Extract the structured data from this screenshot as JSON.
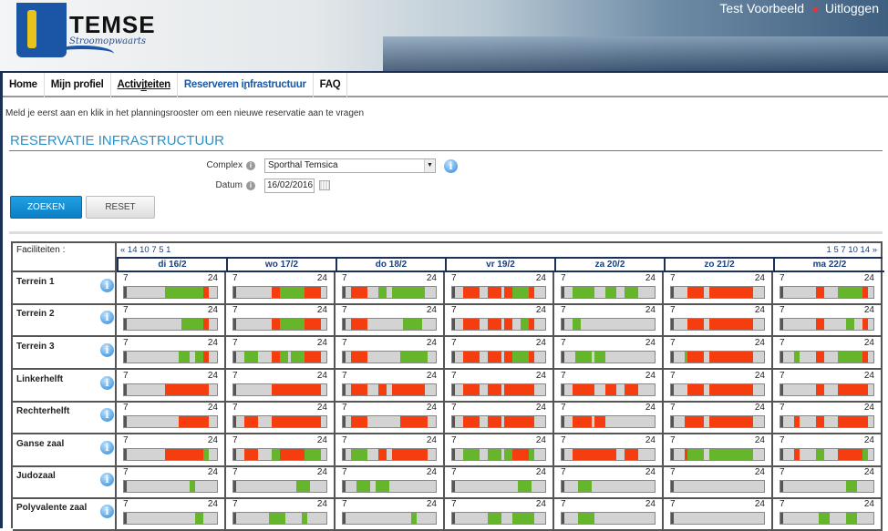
{
  "header": {
    "brand": "TEMSE",
    "slogan": "Stroomopwaarts",
    "user": "Test Voorbeeld",
    "logout": "Uitloggen"
  },
  "nav": [
    {
      "label": "Home"
    },
    {
      "label": "Mijn profiel"
    },
    {
      "label": "Activiteiten",
      "dropdown": true,
      "underline": true
    },
    {
      "label": "Reserveren infrastructuur",
      "dropdown": true,
      "active": true
    },
    {
      "label": "FAQ"
    }
  ],
  "hint": "Meld je eerst aan en klik in het planningsrooster om een nieuwe reservatie aan te vragen",
  "title": "RESERVATIE INFRASTRUCTUUR",
  "form": {
    "complex_label": "Complex",
    "complex_value": "Sporthal Temsica",
    "datum_label": "Datum",
    "datum_value": "16/02/2016",
    "search": "ZOEKEN",
    "reset": "RESET"
  },
  "colors": {
    "reserved": "#f53d0f",
    "free_slot": "#65b62a",
    "empty": "#d3d3d3",
    "accent": "#2b92c9"
  },
  "grid": {
    "facilities_header": "Faciliteiten :",
    "pager_prev": "« 14 10 7 5 1",
    "pager_next": "1 5 7 10 14 »",
    "scale_start": "7",
    "scale_end": "24",
    "days": [
      "di 16/2",
      "wo 17/2",
      "do 18/2",
      "vr 19/2",
      "za 20/2",
      "zo 21/2",
      "ma 22/2"
    ],
    "rows": [
      {
        "name": "Terrein 1",
        "days": [
          [
            [
              14.5,
              21.5,
              "g"
            ],
            [
              21.5,
              22.5,
              "r"
            ]
          ],
          [
            [
              14,
              15.5,
              "r"
            ],
            [
              15.5,
              20,
              "g"
            ],
            [
              20,
              23,
              "r"
            ]
          ],
          [
            [
              8.5,
              11.5,
              "r"
            ],
            [
              13.5,
              15,
              "g"
            ],
            [
              16,
              22,
              "g"
            ]
          ],
          [
            [
              9,
              12,
              "r"
            ],
            [
              13.5,
              16,
              "r"
            ],
            [
              16.5,
              18,
              "r"
            ],
            [
              18,
              21,
              "g"
            ],
            [
              21,
              22,
              "r"
            ]
          ],
          [
            [
              9,
              13,
              "g"
            ],
            [
              15,
              17,
              "g"
            ],
            [
              18.5,
              21,
              "g"
            ]
          ],
          [
            [
              10,
              13,
              "r"
            ],
            [
              14,
              22,
              "r"
            ]
          ],
          [
            [
              13.5,
              15,
              "r"
            ],
            [
              17.5,
              22,
              "g"
            ],
            [
              22,
              23,
              "r"
            ]
          ]
        ]
      },
      {
        "name": "Terrein 2",
        "days": [
          [
            [
              17.5,
              21.5,
              "g"
            ],
            [
              21.5,
              22.5,
              "r"
            ]
          ],
          [
            [
              14,
              15.5,
              "r"
            ],
            [
              15.5,
              20,
              "g"
            ],
            [
              20,
              23,
              "r"
            ]
          ],
          [
            [
              8.5,
              11.5,
              "r"
            ],
            [
              18,
              21.5,
              "g"
            ]
          ],
          [
            [
              9,
              12,
              "r"
            ],
            [
              13.5,
              16,
              "r"
            ],
            [
              16.5,
              18,
              "r"
            ],
            [
              19.5,
              21,
              "g"
            ],
            [
              21,
              22,
              "r"
            ]
          ],
          [
            [
              9,
              10.5,
              "g"
            ]
          ],
          [
            [
              10,
              13,
              "r"
            ],
            [
              14,
              22,
              "r"
            ]
          ],
          [
            [
              13.5,
              15,
              "r"
            ],
            [
              19,
              20.5,
              "g"
            ],
            [
              22,
              23,
              "r"
            ]
          ]
        ]
      },
      {
        "name": "Terrein 3",
        "days": [
          [
            [
              17,
              19,
              "g"
            ],
            [
              20,
              21.5,
              "g"
            ],
            [
              21.5,
              22.5,
              "r"
            ]
          ],
          [
            [
              9,
              11.5,
              "g"
            ],
            [
              14,
              15.5,
              "r"
            ],
            [
              15.5,
              17,
              "g"
            ],
            [
              17.5,
              20,
              "g"
            ],
            [
              20,
              23,
              "r"
            ]
          ],
          [
            [
              8.5,
              11.5,
              "r"
            ],
            [
              17.5,
              22.5,
              "g"
            ]
          ],
          [
            [
              9,
              12,
              "r"
            ],
            [
              13.5,
              16,
              "r"
            ],
            [
              16.5,
              18,
              "r"
            ],
            [
              18,
              21,
              "g"
            ],
            [
              21,
              22,
              "r"
            ]
          ],
          [
            [
              9.5,
              12.5,
              "g"
            ],
            [
              13,
              15,
              "g"
            ]
          ],
          [
            [
              9.5,
              10,
              "g"
            ],
            [
              10,
              13,
              "r"
            ],
            [
              14,
              22,
              "r"
            ]
          ],
          [
            [
              9.5,
              10.5,
              "g"
            ],
            [
              13.5,
              15,
              "r"
            ],
            [
              17.5,
              22,
              "g"
            ],
            [
              22,
              23,
              "r"
            ]
          ]
        ]
      },
      {
        "name": "Linkerhelft",
        "days": [
          [
            [
              14.5,
              22.5,
              "r"
            ]
          ],
          [
            [
              14,
              23,
              "r"
            ]
          ],
          [
            [
              8.5,
              11.5,
              "r"
            ],
            [
              13.5,
              15,
              "r"
            ],
            [
              16,
              22,
              "r"
            ]
          ],
          [
            [
              9,
              12,
              "r"
            ],
            [
              13.5,
              16,
              "r"
            ],
            [
              16.5,
              22,
              "r"
            ]
          ],
          [
            [
              9,
              13,
              "r"
            ],
            [
              15,
              17,
              "r"
            ],
            [
              18.5,
              21,
              "r"
            ]
          ],
          [
            [
              10,
              13,
              "r"
            ],
            [
              14,
              22,
              "r"
            ]
          ],
          [
            [
              13.5,
              15,
              "r"
            ],
            [
              17.5,
              23,
              "r"
            ]
          ]
        ]
      },
      {
        "name": "Rechterhelft",
        "days": [
          [
            [
              17,
              22.5,
              "r"
            ]
          ],
          [
            [
              9,
              11.5,
              "r"
            ],
            [
              14,
              23,
              "r"
            ]
          ],
          [
            [
              8.5,
              11.5,
              "r"
            ],
            [
              17.5,
              22.5,
              "r"
            ]
          ],
          [
            [
              9,
              12,
              "r"
            ],
            [
              13.5,
              16,
              "r"
            ],
            [
              16.5,
              22,
              "r"
            ]
          ],
          [
            [
              9,
              12.5,
              "r"
            ],
            [
              13,
              15,
              "r"
            ]
          ],
          [
            [
              9.5,
              13,
              "r"
            ],
            [
              14,
              22,
              "r"
            ]
          ],
          [
            [
              9.5,
              10.5,
              "r"
            ],
            [
              13.5,
              15,
              "r"
            ],
            [
              17.5,
              23,
              "r"
            ]
          ]
        ]
      },
      {
        "name": "Ganse zaal",
        "days": [
          [
            [
              14.5,
              21.5,
              "r"
            ],
            [
              21.5,
              22.5,
              "g"
            ]
          ],
          [
            [
              9,
              11.5,
              "r"
            ],
            [
              14,
              15.5,
              "g"
            ],
            [
              15.5,
              20,
              "r"
            ],
            [
              20,
              23,
              "g"
            ]
          ],
          [
            [
              8.5,
              11.5,
              "g"
            ],
            [
              13.5,
              15,
              "r"
            ],
            [
              16,
              22.5,
              "r"
            ]
          ],
          [
            [
              9,
              12,
              "g"
            ],
            [
              13.5,
              16,
              "g"
            ],
            [
              16.5,
              18,
              "g"
            ],
            [
              18,
              21,
              "r"
            ],
            [
              21,
              22,
              "g"
            ]
          ],
          [
            [
              9,
              17,
              "r"
            ],
            [
              18.5,
              21,
              "r"
            ]
          ],
          [
            [
              9.5,
              10,
              "r"
            ],
            [
              10,
              13,
              "g"
            ],
            [
              14,
              22,
              "g"
            ]
          ],
          [
            [
              9.5,
              10.5,
              "r"
            ],
            [
              13.5,
              15,
              "g"
            ],
            [
              17.5,
              22,
              "r"
            ],
            [
              22,
              23,
              "g"
            ]
          ]
        ]
      },
      {
        "name": "Judozaal",
        "days": [
          [
            [
              19,
              20,
              "g"
            ]
          ],
          [
            [
              18.5,
              21,
              "g"
            ]
          ],
          [
            [
              9.5,
              12,
              "g"
            ],
            [
              13,
              15.5,
              "g"
            ]
          ],
          [
            [
              19,
              21.5,
              "g"
            ]
          ],
          [
            [
              10,
              12.5,
              "g"
            ]
          ],
          [],
          [
            [
              19,
              21,
              "g"
            ]
          ]
        ]
      },
      {
        "name": "Polyvalente zaal",
        "days": [
          [
            [
              20,
              21.5,
              "g"
            ]
          ],
          [
            [
              13.5,
              16.5,
              "g"
            ],
            [
              19.5,
              20.5,
              "g"
            ]
          ],
          [
            [
              19.5,
              20.5,
              "g"
            ]
          ],
          [
            [
              13.5,
              16,
              "g"
            ],
            [
              18,
              22,
              "g"
            ]
          ],
          [
            [
              10,
              13,
              "g"
            ]
          ],
          [],
          [
            [
              14,
              16,
              "g"
            ],
            [
              19,
              21,
              "g"
            ]
          ]
        ]
      }
    ]
  }
}
